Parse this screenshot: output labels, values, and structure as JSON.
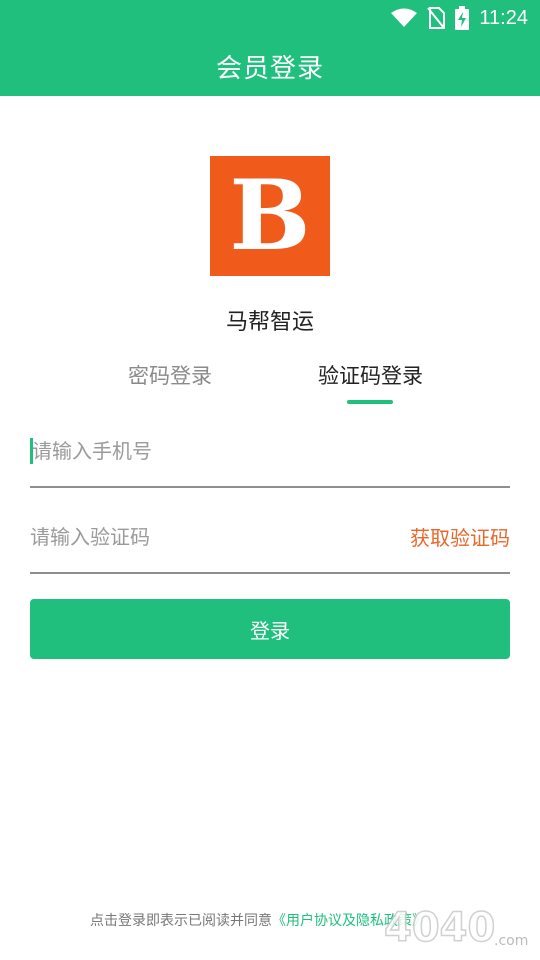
{
  "status_bar": {
    "time": "11:24",
    "icons": [
      "wifi-icon",
      "no-sim-icon",
      "battery-charging-icon"
    ]
  },
  "header": {
    "title": "会员登录"
  },
  "brand": {
    "logo_letter": "B",
    "app_name": "马帮智运",
    "logo_color": "#f05a1a"
  },
  "tabs": [
    {
      "label": "密码登录",
      "active": false
    },
    {
      "label": "验证码登录",
      "active": true
    }
  ],
  "form": {
    "phone": {
      "value": "",
      "placeholder": "请输入手机号"
    },
    "code": {
      "value": "",
      "placeholder": "请输入验证码"
    },
    "get_code_label": "获取验证码",
    "submit_label": "登录"
  },
  "agreement": {
    "prefix": "点击登录即表示已阅读并同意",
    "link": "《用户协议及隐私政策》"
  },
  "watermark": {
    "text": "4040.com"
  },
  "colors": {
    "primary": "#20bf7e",
    "accent": "#e8672b",
    "divider": "#8e8e8e"
  }
}
